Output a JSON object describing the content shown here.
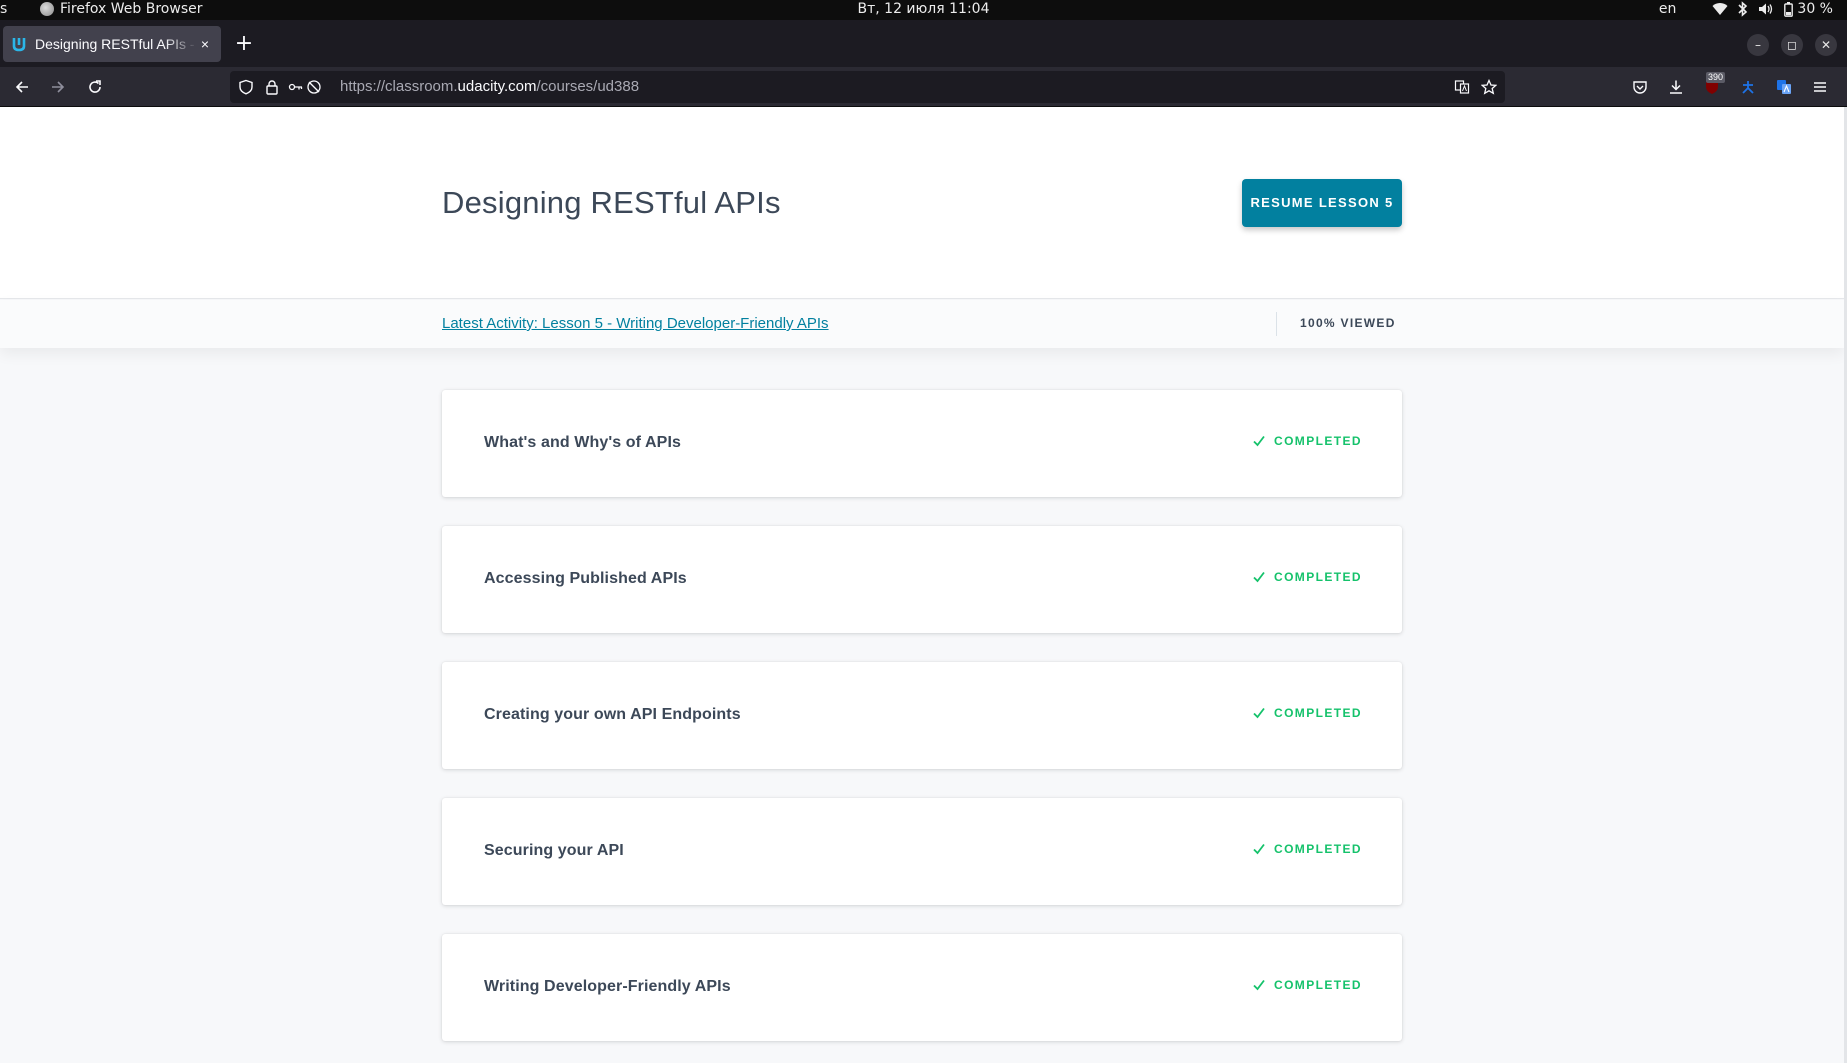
{
  "system_bar": {
    "activities": "s",
    "app_name": "Firefox Web Browser",
    "clock": "Вт, 12 июля  11:04",
    "language": "en",
    "battery": "30 %"
  },
  "browser": {
    "tab_title": "Designing RESTful APIs - Udacity",
    "tab_close": "×",
    "new_tab": "+",
    "url_prefix": "https://classroom.",
    "url_host": "udacity.com",
    "url_path": "/courses/ud388",
    "ublock_badge": "390",
    "window_controls": {
      "minimize": "–",
      "restore": "◻",
      "close": "✕"
    }
  },
  "course": {
    "title": "Designing RESTful APIs",
    "resume_label": "RESUME LESSON 5",
    "latest_activity": "Latest Activity: Lesson 5 - Writing Developer-Friendly APIs",
    "viewed": "100% VIEWED",
    "lessons": [
      {
        "title": "What's and Why's of APIs",
        "status": "COMPLETED"
      },
      {
        "title": "Accessing Published APIs",
        "status": "COMPLETED"
      },
      {
        "title": "Creating your own API Endpoints",
        "status": "COMPLETED"
      },
      {
        "title": "Securing your API",
        "status": "COMPLETED"
      },
      {
        "title": "Writing Developer-Friendly APIs",
        "status": "COMPLETED"
      }
    ]
  },
  "colors": {
    "accent": "#02809f",
    "completed": "#15c26b",
    "text": "#3c4858"
  },
  "icons": {
    "back": "arrow-left-icon",
    "forward": "arrow-right-icon",
    "reload": "reload-icon",
    "completed": "checkmark-icon"
  }
}
